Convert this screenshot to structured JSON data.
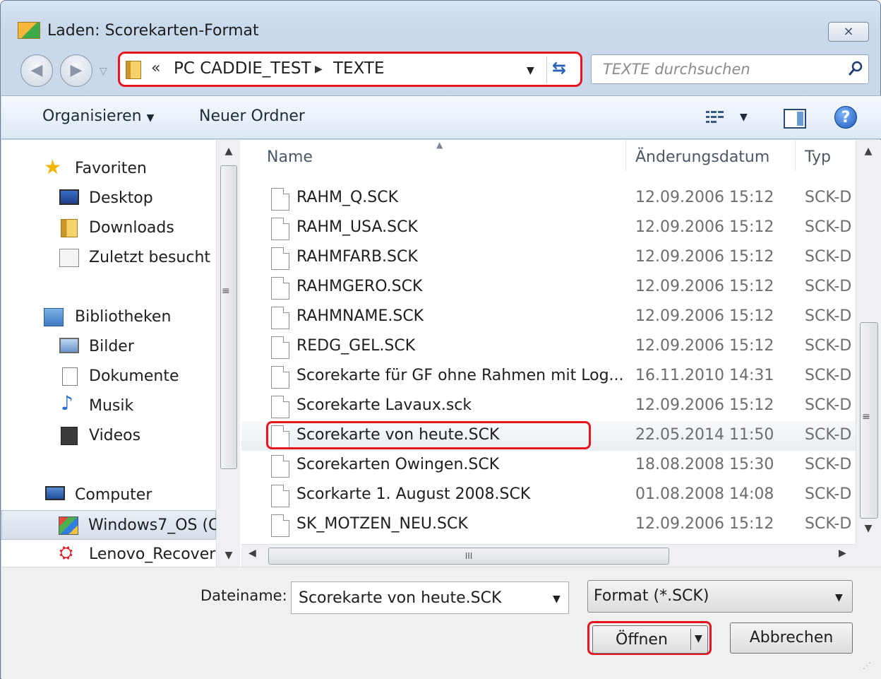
{
  "window": {
    "title": "Laden: Scorekarten-Format",
    "close_label": "⨯"
  },
  "address": {
    "overflow": "«",
    "segments": [
      "PC CADDIE_TEST",
      "TEXTE"
    ],
    "search_placeholder": "TEXTE durchsuchen"
  },
  "toolbar": {
    "organize_label": "Organisieren",
    "new_folder_label": "Neuer Ordner"
  },
  "nav": {
    "favorites": "Favoriten",
    "desktop": "Desktop",
    "downloads": "Downloads",
    "recent": "Zuletzt besucht",
    "libraries": "Bibliotheken",
    "pictures": "Bilder",
    "documents": "Dokumente",
    "music": "Musik",
    "videos": "Videos",
    "computer": "Computer",
    "drive_c": "Windows7_OS (C",
    "drive_recovery": "Lenovo_Recovery"
  },
  "columns": {
    "name": "Name",
    "date": "Änderungsdatum",
    "type": "Typ"
  },
  "files": [
    {
      "name": "RAHM_Q.SCK",
      "date": "12.09.2006 15:12",
      "type": "SCK-D"
    },
    {
      "name": "RAHM_USA.SCK",
      "date": "12.09.2006 15:12",
      "type": "SCK-D"
    },
    {
      "name": "RAHMFARB.SCK",
      "date": "12.09.2006 15:12",
      "type": "SCK-D"
    },
    {
      "name": "RAHMGERO.SCK",
      "date": "12.09.2006 15:12",
      "type": "SCK-D"
    },
    {
      "name": "RAHMNAME.SCK",
      "date": "12.09.2006 15:12",
      "type": "SCK-D"
    },
    {
      "name": "REDG_GEL.SCK",
      "date": "12.09.2006 15:12",
      "type": "SCK-D"
    },
    {
      "name": "Scorekarte für GF ohne Rahmen mit Log...",
      "date": "16.11.2010 14:31",
      "type": "SCK-D"
    },
    {
      "name": "Scorekarte Lavaux.sck",
      "date": "12.09.2006 15:12",
      "type": "SCK-D"
    },
    {
      "name": "Scorekarte von heute.SCK",
      "date": "22.05.2014 11:50",
      "type": "SCK-D"
    },
    {
      "name": "Scorekarten Owingen.SCK",
      "date": "18.08.2008 15:30",
      "type": "SCK-D"
    },
    {
      "name": "Scorkarte 1. August 2008.SCK",
      "date": "01.08.2008 14:08",
      "type": "SCK-D"
    },
    {
      "name": "SK_MOTZEN_NEU.SCK",
      "date": "12.09.2006 15:12",
      "type": "SCK-D"
    }
  ],
  "bottom": {
    "filename_label": "Dateiname:",
    "filename_value": "Scorekarte von heute.SCK",
    "format_value": "Format (*.SCK)",
    "open_label": "Öffnen",
    "cancel_label": "Abbrechen"
  },
  "colors": {
    "highlight_red": "#e8141e",
    "toolbar_blue": "#dde8f5"
  }
}
